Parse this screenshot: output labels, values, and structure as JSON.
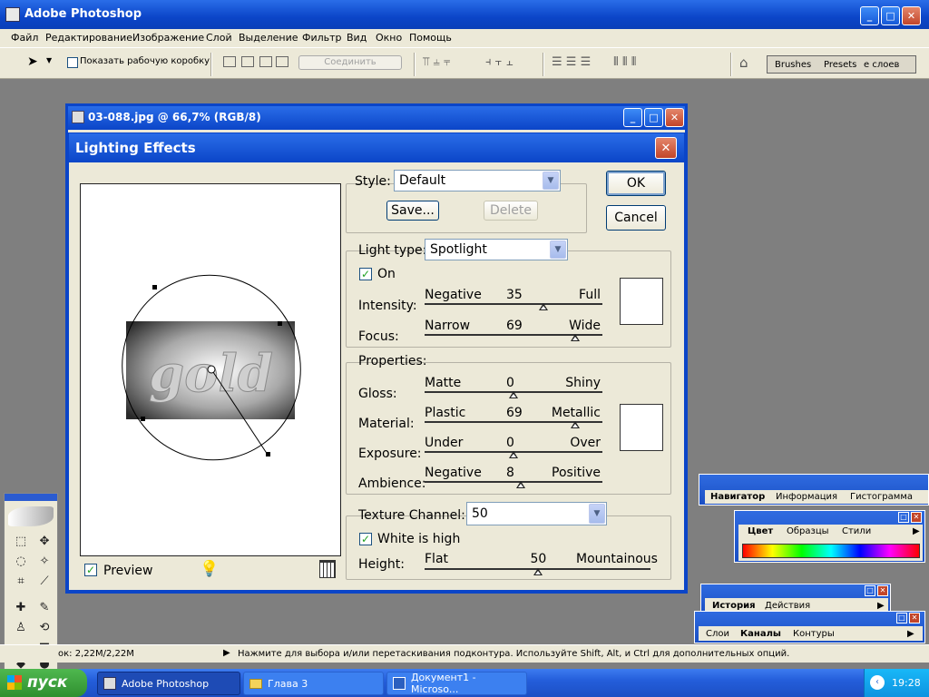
{
  "app": {
    "title": "Adobe Photoshop"
  },
  "menu": [
    "Файл",
    "Редактирование",
    "Изображение",
    "Слой",
    "Выделение",
    "Фильтр",
    "Вид",
    "Окно",
    "Помощь"
  ],
  "options_bar": {
    "show_bbox_label": "Показать рабочую коробку",
    "combine_label": "Соединить",
    "palette_tabs": [
      "Brushes",
      "Presets",
      "е слоев"
    ]
  },
  "document": {
    "title": "03-088.jpg @ 66,7% (RGB/8)"
  },
  "dialog": {
    "title": "Lighting Effects",
    "preview_label": "Preview",
    "preview_checked": true,
    "preview_text": "gold",
    "style": {
      "label": "Style:",
      "value": "Default",
      "save": "Save...",
      "delete": "Delete"
    },
    "ok": "OK",
    "cancel": "Cancel",
    "light_type": {
      "label": "Light type:",
      "value": "Spotlight",
      "on_label": "On",
      "on_checked": true
    },
    "light_sliders": [
      {
        "label": "Intensity:",
        "min": "Negative",
        "max": "Full",
        "value": "35",
        "pos": 0.67
      },
      {
        "label": "Focus:",
        "min": "Narrow",
        "max": "Wide",
        "value": "69",
        "pos": 0.845
      }
    ],
    "properties": {
      "label": "Properties:"
    },
    "prop_sliders": [
      {
        "label": "Gloss:",
        "min": "Matte",
        "max": "Shiny",
        "value": "0",
        "pos": 0.5
      },
      {
        "label": "Material:",
        "min": "Plastic",
        "max": "Metallic",
        "value": "69",
        "pos": 0.845
      },
      {
        "label": "Exposure:",
        "min": "Under",
        "max": "Over",
        "value": "0",
        "pos": 0.5
      },
      {
        "label": "Ambience:",
        "min": "Negative",
        "max": "Positive",
        "value": "8",
        "pos": 0.54
      }
    ],
    "texture": {
      "label": "Texture Channel:",
      "value": "50",
      "white_is_high": "White is high",
      "white_checked": true,
      "height_label": "Height:",
      "min": "Flat",
      "max": "Mountainous",
      "pos": 0.5
    }
  },
  "panels": {
    "navigator_tabs": [
      "Навигатор",
      "Информация",
      "Гистограмма"
    ],
    "color_tabs": [
      "Цвет",
      "Образцы",
      "Стили"
    ],
    "history_tabs": [
      "История",
      "Действия"
    ],
    "layers_tabs": [
      "Слои",
      "Каналы",
      "Контуры"
    ]
  },
  "status": {
    "doc_size": "ок: 2,22M/2,22M",
    "hint": "Нажмите для выбора и/или перетаскивания подконтура. Используйте Shift, Alt, и Ctrl для дополнительных опций."
  },
  "taskbar": {
    "start": "пуск",
    "items": [
      "Adobe Photoshop",
      "Глава 3",
      "Документ1 - Microso..."
    ],
    "clock": "19:28"
  },
  "colors": {
    "xp_blue": "#245edb",
    "dialog_bg": "#ece9d8",
    "start_green": "#3c9a3c"
  }
}
